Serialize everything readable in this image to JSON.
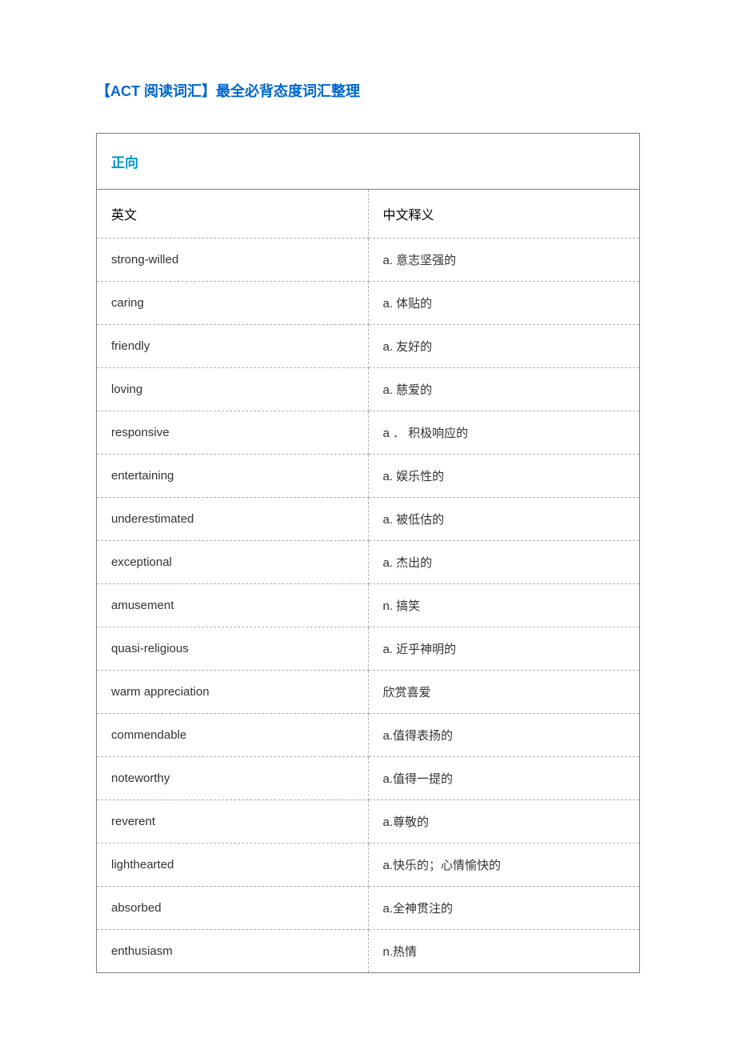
{
  "title": "【ACT 阅读词汇】最全必背态度词汇整理",
  "section": "正向",
  "columns": {
    "en": "英文",
    "zh": "中文释义"
  },
  "rows": [
    {
      "en": "strong-willed",
      "zh": "a.  意志坚强的"
    },
    {
      "en": "caring",
      "zh": "a.  体贴的"
    },
    {
      "en": "friendly",
      "zh": "a.  友好的"
    },
    {
      "en": "loving",
      "zh": "a.  慈爱的"
    },
    {
      "en": "responsive",
      "zh": "a ．  积极响应的"
    },
    {
      "en": "entertaining",
      "zh": "a.  娱乐性的"
    },
    {
      "en": "underestimated",
      "zh": "a.  被低估的"
    },
    {
      "en": "exceptional",
      "zh": "a.  杰出的"
    },
    {
      "en": "amusement",
      "zh": "n.  搞笑"
    },
    {
      "en": "quasi-religious",
      "zh": "a.  近乎神明的"
    },
    {
      "en": "warm  appreciation",
      "zh": "欣赏喜爱"
    },
    {
      "en": "commendable",
      "zh": "a.值得表扬的"
    },
    {
      "en": "noteworthy",
      "zh": "a.值得一提的"
    },
    {
      "en": "reverent",
      "zh": "a.尊敬的"
    },
    {
      "en": "lighthearted",
      "zh": "a.快乐的；心情愉快的"
    },
    {
      "en": "absorbed",
      "zh": "a.全神贯注的"
    },
    {
      "en": "enthusiasm",
      "zh": "n.热情"
    }
  ]
}
